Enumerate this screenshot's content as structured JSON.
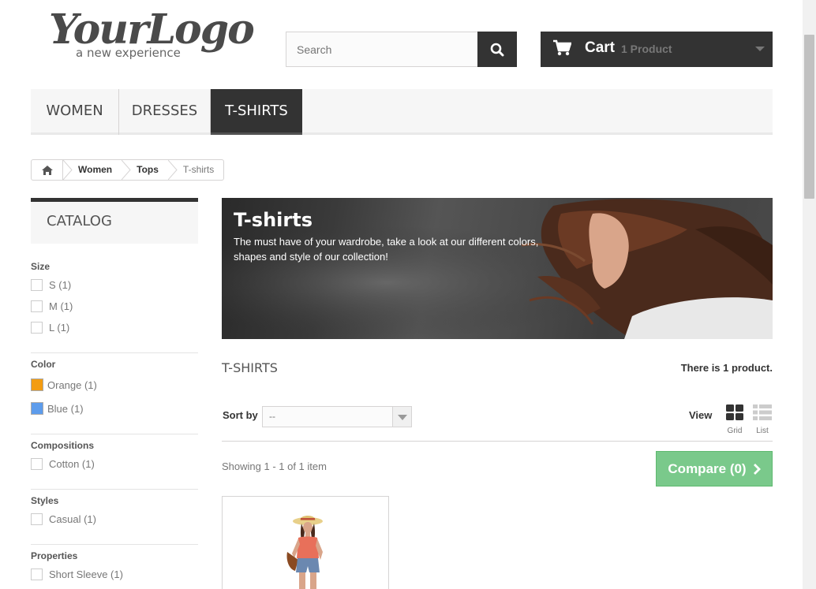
{
  "header": {
    "logo_main": "YourLogo",
    "logo_sub": "a new experience",
    "search": {
      "placeholder": "Search"
    },
    "cart": {
      "label": "Cart",
      "count_text": "1 Product"
    }
  },
  "menu": {
    "items": [
      {
        "label": "WOMEN"
      },
      {
        "label": "DRESSES"
      },
      {
        "label": "T-SHIRTS"
      }
    ]
  },
  "breadcrumb": {
    "items": [
      "Women",
      "Tops",
      "T-shirts"
    ]
  },
  "sidebar": {
    "title": "CATALOG",
    "filters": {
      "size": {
        "title": "Size",
        "options": [
          "S (1)",
          "M (1)",
          "L (1)"
        ]
      },
      "color": {
        "title": "Color",
        "options": [
          {
            "label": "Orange (1)",
            "color": "#f39c11"
          },
          {
            "label": "Blue (1)",
            "color": "#5d9cec"
          }
        ]
      },
      "compositions": {
        "title": "Compositions",
        "options": [
          "Cotton (1)"
        ]
      },
      "styles": {
        "title": "Styles",
        "options": [
          "Casual (1)"
        ]
      },
      "properties": {
        "title": "Properties",
        "options": [
          "Short Sleeve (1)"
        ]
      }
    }
  },
  "banner": {
    "title": "T-shirts",
    "description": "The must have of your wardrobe, take a look at our different colors, shapes and style of our collection!"
  },
  "category": {
    "name": "T-SHIRTS",
    "counter": "There is 1 product."
  },
  "toolbar": {
    "sort_label": "Sort by",
    "sort_value": "--",
    "view_label": "View",
    "grid_label": "Grid",
    "list_label": "List",
    "showing": "Showing 1 - 1 of 1 item",
    "compare_label": "Compare (0)"
  },
  "colors": {
    "dark": "#333333",
    "compare_green": "#7ac98b",
    "menu_bg": "#f6f6f6"
  }
}
